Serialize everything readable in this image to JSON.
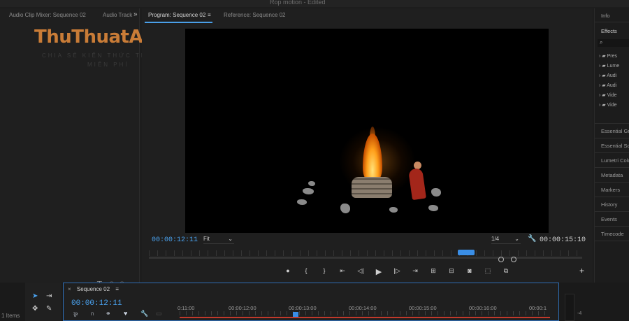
{
  "app": {
    "title": "Rop motion - Edited"
  },
  "watermark": {
    "title": "ThuThuatApp",
    "subtitle_line1": "CHIA SẺ KIẾN THỨC TIN HỌC",
    "subtitle_line2": "MIỄN PHÍ"
  },
  "left_panel": {
    "tabs": [
      {
        "label": "Audio Clip Mixer: Sequence 02"
      },
      {
        "label": "Audio Track"
      }
    ],
    "overflow_icon": "chevron-double-right-icon"
  },
  "program_monitor": {
    "tabs": [
      {
        "label": "Program: Sequence 02",
        "active": true
      },
      {
        "label": "Reference: Sequence 02",
        "active": false
      }
    ],
    "menu_icon": "≡",
    "current_timecode": "00:00:12:11",
    "zoom": "Fit",
    "resolution": "1/4",
    "duration": "00:00:15:10",
    "transport_icons": [
      "marker-icon",
      "in-point-icon",
      "out-point-icon",
      "go-to-in-icon",
      "step-back-icon",
      "play-icon",
      "step-forward-icon",
      "go-to-out-icon",
      "insert-icon",
      "overwrite-icon",
      "export-frame-icon",
      "lift-icon",
      "extract-icon"
    ],
    "colors": {
      "timecode": "#4aa3f0",
      "accent": "#3a8ee6"
    }
  },
  "right_panel": {
    "items": [
      {
        "label": "Info"
      },
      {
        "label": "Effects",
        "active": true
      }
    ],
    "search_icon": "search-icon",
    "tree": [
      {
        "label": "Pres"
      },
      {
        "label": "Lume"
      },
      {
        "label": "Audi"
      },
      {
        "label": "Audi"
      },
      {
        "label": "Vide"
      },
      {
        "label": "Vide"
      }
    ],
    "panels": [
      {
        "label": "Essential Gr"
      },
      {
        "label": "Essential So"
      },
      {
        "label": "Lumetri Colo"
      },
      {
        "label": "Metadata"
      },
      {
        "label": "Markers"
      },
      {
        "label": "History"
      },
      {
        "label": "Events"
      },
      {
        "label": "Timecode"
      }
    ]
  },
  "project_panel": {
    "items_count": "1 Items"
  },
  "timeline": {
    "sequence_tab": "Sequence 02",
    "close_icon": "×",
    "menu_icon": "≡",
    "current_timecode": "00:00:12:11",
    "ruler_labels": [
      "0:11:00",
      "00:00:12:00",
      "00:00:13:00",
      "00:00:14:00",
      "00:00:15:00",
      "00:00:16:00",
      "00:00:1"
    ],
    "meter_label": "-4",
    "colors": {
      "border": "#2e6db4",
      "work_area": "#c0392b"
    }
  }
}
